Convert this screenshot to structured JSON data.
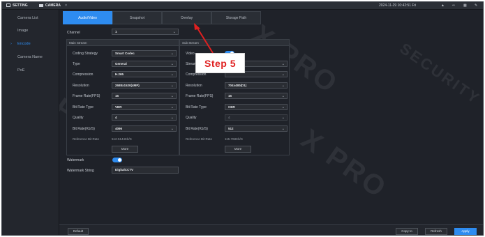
{
  "topbar": {
    "setting_label": "SETTING",
    "camera_label": "CAMERA",
    "close_label": "×",
    "datetime": "2024-11-29 10:42:51 Fri"
  },
  "sidebar": {
    "items": [
      {
        "label": "Camera List"
      },
      {
        "label": "Image"
      },
      {
        "label": "Encode"
      },
      {
        "label": "Camera Name"
      },
      {
        "label": "PoE"
      }
    ]
  },
  "tabs": [
    "Audio/Video",
    "Snapshot",
    "Overlay",
    "Storage Path"
  ],
  "channel": {
    "label": "Channel",
    "value": "1"
  },
  "main_stream": {
    "title": "Main Stream",
    "fields": [
      {
        "label": "Coding Strategy",
        "value": "Smart Codec"
      },
      {
        "label": "Type",
        "value": "General"
      },
      {
        "label": "Compression",
        "value": "H.265"
      },
      {
        "label": "Resolution",
        "value": "2688x1520(4MP)"
      },
      {
        "label": "Frame Rate(FPS)",
        "value": "15"
      },
      {
        "label": "Bit Rate Type",
        "value": "VBR"
      },
      {
        "label": "Quality",
        "value": "4"
      },
      {
        "label": "Bit Rate(Kb/S)",
        "value": "4096"
      }
    ],
    "reference_label": "Reference Bit Rate",
    "reference_value": "512-5144Kb/S",
    "more_label": "More"
  },
  "sub_stream": {
    "title": "Sub Stream",
    "video_label": "Video",
    "fields": [
      {
        "label": "Stream",
        "value": ""
      },
      {
        "label": "Compression",
        "value": ""
      },
      {
        "label": "Resolution",
        "value": "704x480(D1)"
      },
      {
        "label": "Frame Rate(FPS)",
        "value": "15"
      },
      {
        "label": "Bit Rate Type",
        "value": "CBR"
      },
      {
        "label": "Quality",
        "value": "4"
      },
      {
        "label": "Bit Rate(Kb/S)",
        "value": "512"
      }
    ],
    "reference_label": "Reference Bit Rate",
    "reference_value": "115-768Kb/S",
    "more_label": "More"
  },
  "watermark": {
    "label": "Watermark",
    "enabled": true
  },
  "watermark_string": {
    "label": "Watermark String",
    "value": "DigitalCCTV"
  },
  "footer": {
    "default_label": "Default",
    "copy_label": "Copy to",
    "refresh_label": "Refresh",
    "apply_label": "Apply"
  },
  "annotation": {
    "text": "Step 5"
  },
  "watermark_text": [
    "X PRO",
    "SECURITY"
  ],
  "colors": {
    "accent": "#2e8cf0",
    "annotation": "#e02020",
    "background": "#1f2229"
  }
}
